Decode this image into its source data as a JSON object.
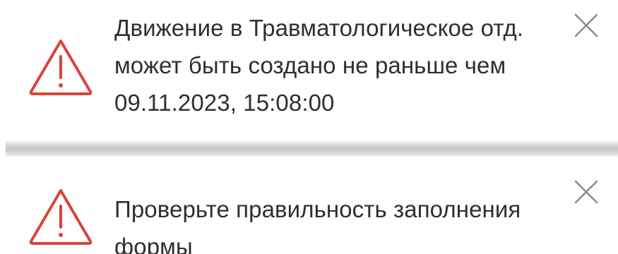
{
  "notifications": [
    {
      "type": "warning",
      "icon": "warning-triangle-icon",
      "lines": [
        "Движение в Травматологическое отд.",
        "может быть создано не раньше чем",
        "09.11.2023, 15:08:00"
      ],
      "close_icon": "close-icon"
    },
    {
      "type": "warning",
      "icon": "warning-triangle-icon",
      "lines": [
        "Проверьте правильность заполнения",
        "формы"
      ],
      "close_icon": "close-icon"
    }
  ],
  "colors": {
    "warning": "#d9443a",
    "text": "#2f2f2f",
    "close": "#8c8c8c"
  }
}
